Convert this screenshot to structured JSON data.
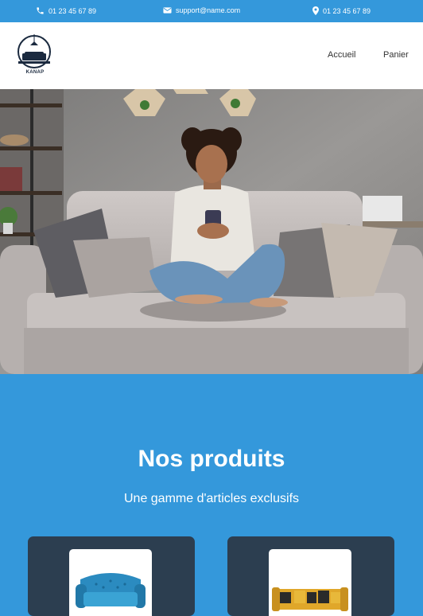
{
  "topbar": {
    "phone_left": "01 23 45 67 89",
    "email": "support@name.com",
    "phone_right": "01 23 45 67 89"
  },
  "brand": {
    "logo_text": "KANAP"
  },
  "nav": [
    {
      "label": "Accueil"
    },
    {
      "label": "Panier"
    }
  ],
  "colors": {
    "accent": "#3498db",
    "card": "#2c3e50",
    "white": "#ffffff"
  },
  "products": {
    "title": "Nos produits",
    "subtitle": "Une gamme d'articles exclusifs"
  }
}
